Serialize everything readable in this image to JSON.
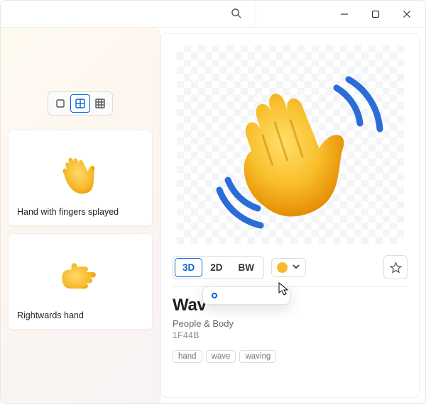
{
  "window_controls": {
    "minimize": "minimize",
    "maximize": "maximize",
    "close": "close"
  },
  "left_panel": {
    "view_modes": [
      "single",
      "grid-2",
      "grid-3"
    ],
    "active_view": "grid-2",
    "cards": [
      {
        "label": "Hand with fingers splayed"
      },
      {
        "label": "Rightwards hand"
      }
    ]
  },
  "detail": {
    "title_visible": "Wav",
    "category": "People & Body",
    "codepoint": "1F44B",
    "styles": [
      {
        "key": "3d",
        "label": "3D",
        "active": true
      },
      {
        "key": "2d",
        "label": "2D",
        "active": false
      },
      {
        "key": "bw",
        "label": "BW",
        "active": false
      }
    ],
    "tags": [
      "hand",
      "wave",
      "waving"
    ],
    "skin_tones": [
      {
        "hex": "#f7b928",
        "selected": true
      },
      {
        "hex": "#e9c6a7",
        "selected": false
      },
      {
        "hex": "#d4a276",
        "selected": false
      },
      {
        "hex": "#b47e50",
        "selected": false
      },
      {
        "hex": "#8a5a38",
        "selected": false
      },
      {
        "hex": "#5c3a22",
        "selected": false
      }
    ],
    "current_tone": "#f7b928"
  }
}
